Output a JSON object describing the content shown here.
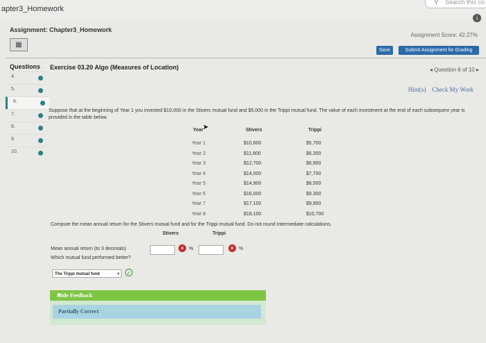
{
  "window": {
    "title": "apter3_Homework",
    "search_text": "Search this co"
  },
  "assignment": {
    "title": "Assignment: Chapter3_Homework",
    "score": "Assignment Score: 42.27%"
  },
  "buttons": {
    "save": "Save",
    "submit": "Submit Assignment for Grading"
  },
  "questions": {
    "header": "Questions",
    "items": [
      {
        "num": "4."
      },
      {
        "num": "5."
      },
      {
        "num": "6."
      },
      {
        "num": "7."
      },
      {
        "num": "8."
      },
      {
        "num": "9."
      },
      {
        "num": "10."
      }
    ]
  },
  "exercise": {
    "title": "Exercise 03.20 Algo (Measures of Location)",
    "nav": "◂ Question 6 of 10 ▸",
    "hint": "Hint(s)",
    "check": "Check My Work",
    "text": "Suppose that at the beginning of Year 1 you invested $10,000 in the Stivers mutual fund and $5,000 in the Trippi mutual fund. The value of each investment at the end of each subsequent year is provided in the table below."
  },
  "table": {
    "headers": [
      "Year",
      "Stivers",
      "Trippi"
    ],
    "rows": [
      [
        "Year 1",
        "$10,600",
        "$5,700"
      ],
      [
        "Year 2",
        "$11,600",
        "$6,300"
      ],
      [
        "Year 3",
        "$12,700",
        "$6,900"
      ],
      [
        "Year 4",
        "$14,000",
        "$7,700"
      ],
      [
        "Year 5",
        "$14,900",
        "$8,500"
      ],
      [
        "Year 6",
        "$16,000",
        "$9,300"
      ],
      [
        "Year 7",
        "$17,100",
        "$9,900"
      ],
      [
        "Year 8",
        "$18,100",
        "$10,700"
      ]
    ]
  },
  "compute": {
    "text": "Compute the mean annual return for the Stivers mutual fund and for the Trippi mutual fund. Do not round intermediate calculations.",
    "col_stivers": "Stivers",
    "col_trippi": "Trippi",
    "mean_label": "Mean annual return (to 3 decimals)",
    "pct": "%",
    "which_label": "Which mutual fund performed better?",
    "selected": "The Trippi mutual fund"
  },
  "feedback": {
    "toggle": "Hide Feedback",
    "status": "Partially Correct"
  }
}
